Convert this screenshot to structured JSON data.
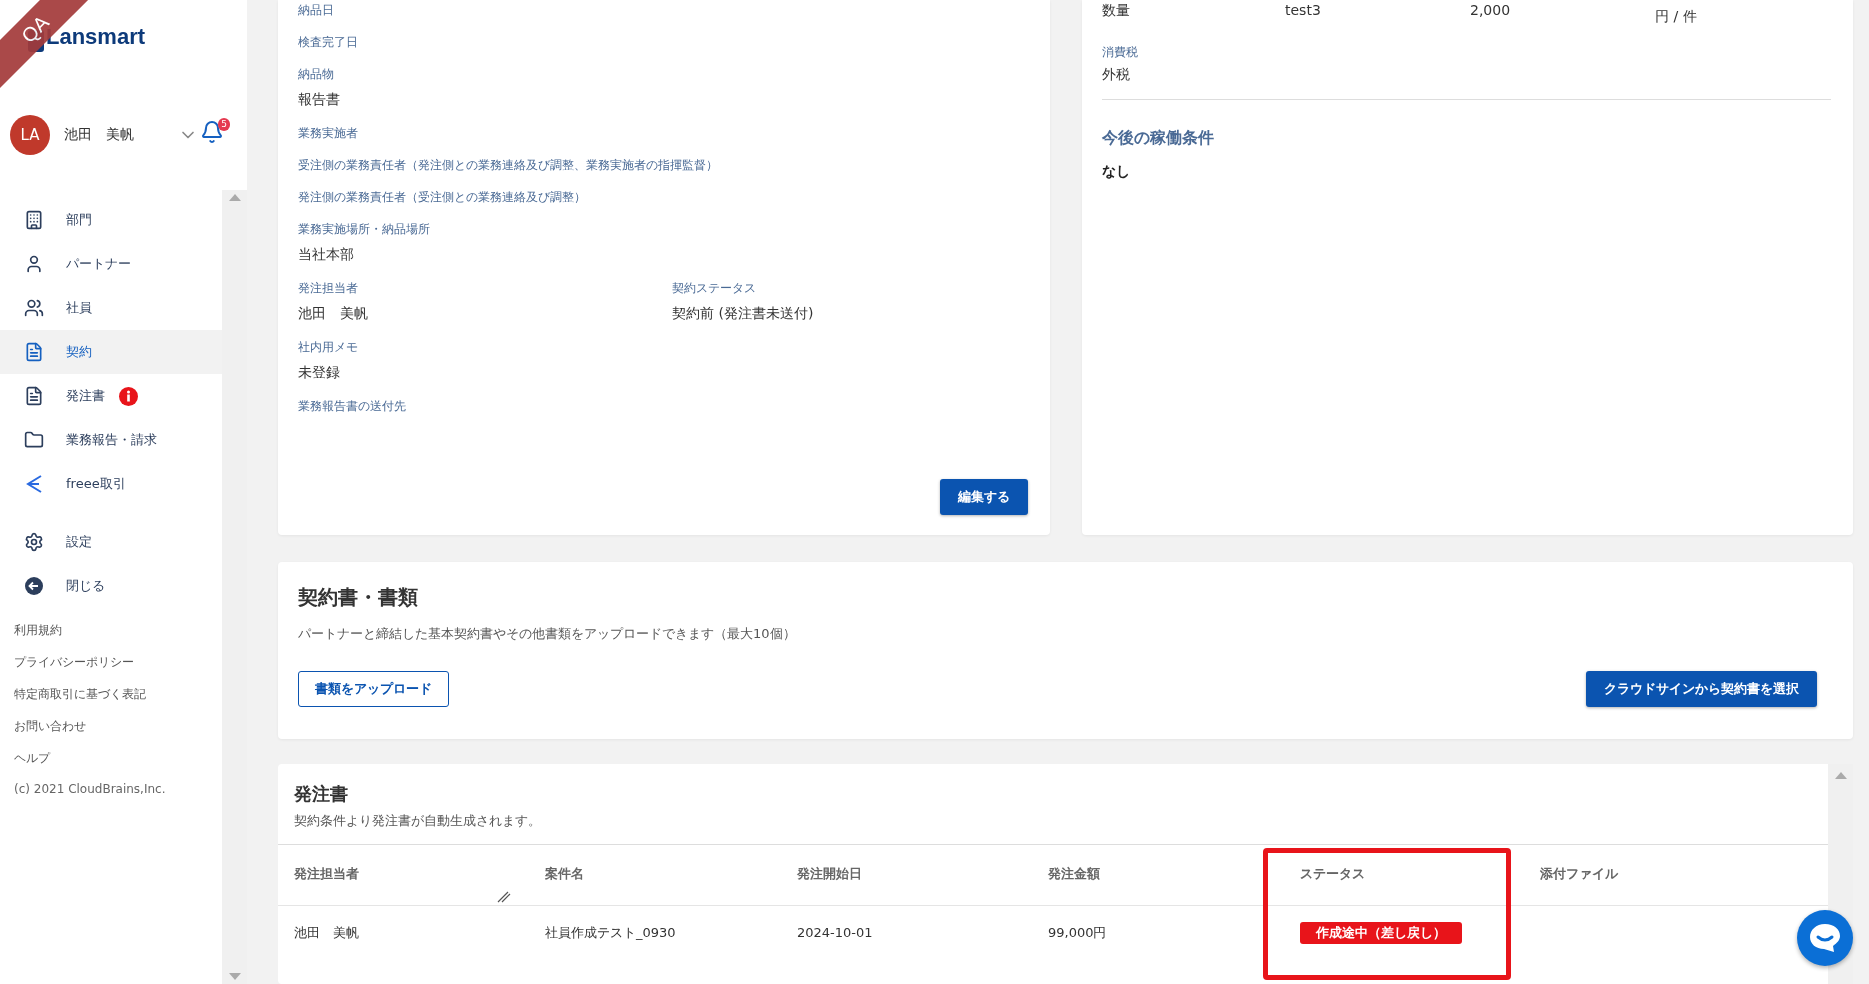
{
  "environment_ribbon": "QA",
  "sidebar": {
    "logo": "Lansmart",
    "user": {
      "initials": "LA",
      "name": "池田　美帆"
    },
    "notification_count": "5",
    "nav": [
      {
        "label": "部門",
        "selected": false,
        "alert": false
      },
      {
        "label": "パートナー",
        "selected": false,
        "alert": false
      },
      {
        "label": "社員",
        "selected": false,
        "alert": false
      },
      {
        "label": "契約",
        "selected": true,
        "alert": false
      },
      {
        "label": "発注書",
        "selected": false,
        "alert": true
      },
      {
        "label": "業務報告・請求",
        "selected": false,
        "alert": false
      },
      {
        "label": "freee取引",
        "selected": false,
        "alert": false
      }
    ],
    "secondary_nav": [
      {
        "label": "設定"
      },
      {
        "label": "閉じる"
      }
    ],
    "footer_links": [
      "利用規約",
      "プライバシーポリシー",
      "特定商取引に基づく表記",
      "お問い合わせ",
      "ヘルプ"
    ],
    "copyright": "(c) 2021 CloudBrains,Inc."
  },
  "details": {
    "rows": [
      [
        {
          "label": "納品日"
        }
      ],
      [
        {
          "label": "検査完了日"
        }
      ],
      [
        {
          "label": "納品物",
          "value": "報告書"
        }
      ],
      [
        {
          "label": "業務実施者"
        }
      ],
      [
        {
          "label": "受注側の業務責任者（発注側との業務連絡及び調整、業務実施者の指揮監督）"
        }
      ],
      [
        {
          "label": "発注側の業務責任者（受注側との業務連絡及び調整）"
        }
      ],
      [
        {
          "label": "業務実施場所・納品場所",
          "value": "当社本部"
        }
      ],
      [
        {
          "label": "発注担当者",
          "value": "池田　美帆"
        },
        {
          "label": "契約ステータス",
          "value": "契約前 (発注書未送付)"
        }
      ],
      [
        {
          "label": "社内用メモ",
          "value": "未登録"
        }
      ],
      [
        {
          "label": "業務報告書の送付先"
        }
      ]
    ],
    "edit_button": "編集する"
  },
  "pricing": {
    "quantity_row": [
      "数量",
      "test3",
      "2,000",
      "円 / 件"
    ],
    "tax": {
      "label": "消費税",
      "value": "外税"
    },
    "future_conditions": {
      "title": "今後の稼働条件",
      "value": "なし"
    }
  },
  "documents": {
    "title": "契約書・書類",
    "description": "パートナーと締結した基本契約書やその他書類をアップロードできます（最大10個）",
    "upload_button": "書類をアップロード",
    "cloudsign_button": "クラウドサインから契約書を選択"
  },
  "purchase_orders": {
    "title": "発注書",
    "description": "契約条件より発注書が自動生成されます。",
    "columns": [
      "発注担当者",
      "案件名",
      "発注開始日",
      "発注金額",
      "ステータス",
      "添付ファイル"
    ],
    "rows": [
      {
        "cells": [
          "池田　美帆",
          "社員作成テスト_0930",
          "2024-10-01",
          "99,000円"
        ],
        "status": "作成途中（差し戻し）",
        "color": "#e8141a"
      }
    ]
  }
}
